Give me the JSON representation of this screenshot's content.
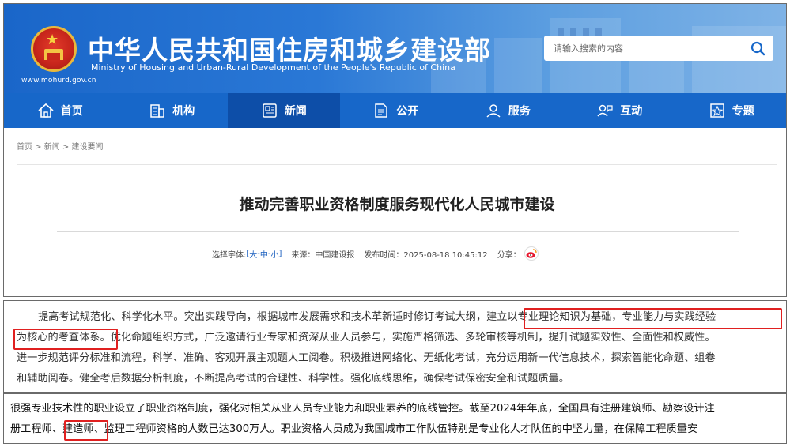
{
  "header": {
    "title": "中华人民共和国住房和城乡建设部",
    "subtitle": "Ministry of Housing and Urban-Rural Development of the People's Republic of China",
    "url": "www.mohurd.gov.cn",
    "search_placeholder": "请输入搜索的内容"
  },
  "nav": [
    {
      "label": "首页",
      "icon": "home-icon"
    },
    {
      "label": "机构",
      "icon": "building-icon"
    },
    {
      "label": "新闻",
      "icon": "news-icon",
      "active": true
    },
    {
      "label": "公开",
      "icon": "document-icon"
    },
    {
      "label": "服务",
      "icon": "service-icon"
    },
    {
      "label": "互动",
      "icon": "interaction-icon"
    },
    {
      "label": "专题",
      "icon": "topic-icon"
    }
  ],
  "breadcrumb": {
    "home": "首页",
    "sep1": " > ",
    "news": "新闻",
    "sep2": " > ",
    "section": "建设要闻"
  },
  "article": {
    "title": "推动完善职业资格制度服务现代化人民城市建设",
    "font_label": "选择字体:",
    "font_open": "[",
    "font_large": "大",
    "font_dash1": "-",
    "font_medium": "中",
    "font_dash2": "-",
    "font_small": "小",
    "font_close": "]",
    "source": "来源：中国建设报",
    "date": "发布时间：2025-08-18 10:45:12",
    "share_label": "分享："
  },
  "excerpt1": {
    "l1a": "提高考试规范化、科学化水平。突出实践导向，根据城市发展需求和技术革新适时修订考试大纲，",
    "l1b": "建立以专业理论知识为基础，专业能力与实践经验",
    "l2a": "为核心的考查体系。",
    "l2b": "优化命题组织方式，广泛邀请行业专家和资深从业人员参与，实施严格筛选、多轮审核等机制，提升试题实效性、全面性和权威性。",
    "l3": "进一步规范评分标准和流程，科学、准确、客观开展主观题人工阅卷。积极推进网络化、无纸化考试，充分运用新一代信息技术，探索智能化命题、组卷",
    "l4": "和辅助阅卷。健全考后数据分析制度，不断提高考试的合理性、科学性。强化底线思维，确保考试保密安全和试题质量。"
  },
  "excerpt2": {
    "l1": "很强专业技术性的职业设立了职业资格制度，强化对相关从业人员专业能力和职业素养的底线管控。截至2024年年底，全国具有注册建筑师、勘察设计注",
    "l2a": "册工程师、",
    "l2b": "建造师",
    "l2c": "、监理工程师资格的人数已达300万人。职业资格人员成为我国城市工作队伍特别是专业化人才队伍的中坚力量，在保障工程质量安"
  },
  "colors": {
    "header_blue": "#1a66c9",
    "nav_blue": "#1767c9",
    "nav_active": "#0d4ea8",
    "highlight_red": "#e02020",
    "link_blue": "#1a5fbf"
  }
}
